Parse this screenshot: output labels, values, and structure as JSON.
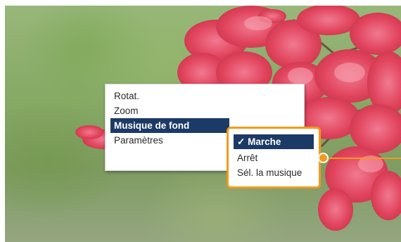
{
  "menu": {
    "items": [
      {
        "label": "Rotat."
      },
      {
        "label": "Zoom"
      },
      {
        "label": "Musique de fond"
      },
      {
        "label": "Paramètres"
      }
    ],
    "selected_index": 2
  },
  "submenu": {
    "check_mark": "✓",
    "items": [
      {
        "label": "Marche"
      },
      {
        "label": "Arrêt"
      },
      {
        "label": "Sél. la musique"
      }
    ],
    "selected_index": 0
  },
  "colors": {
    "highlight": "#1c3a66",
    "callout": "#f39a1d"
  }
}
